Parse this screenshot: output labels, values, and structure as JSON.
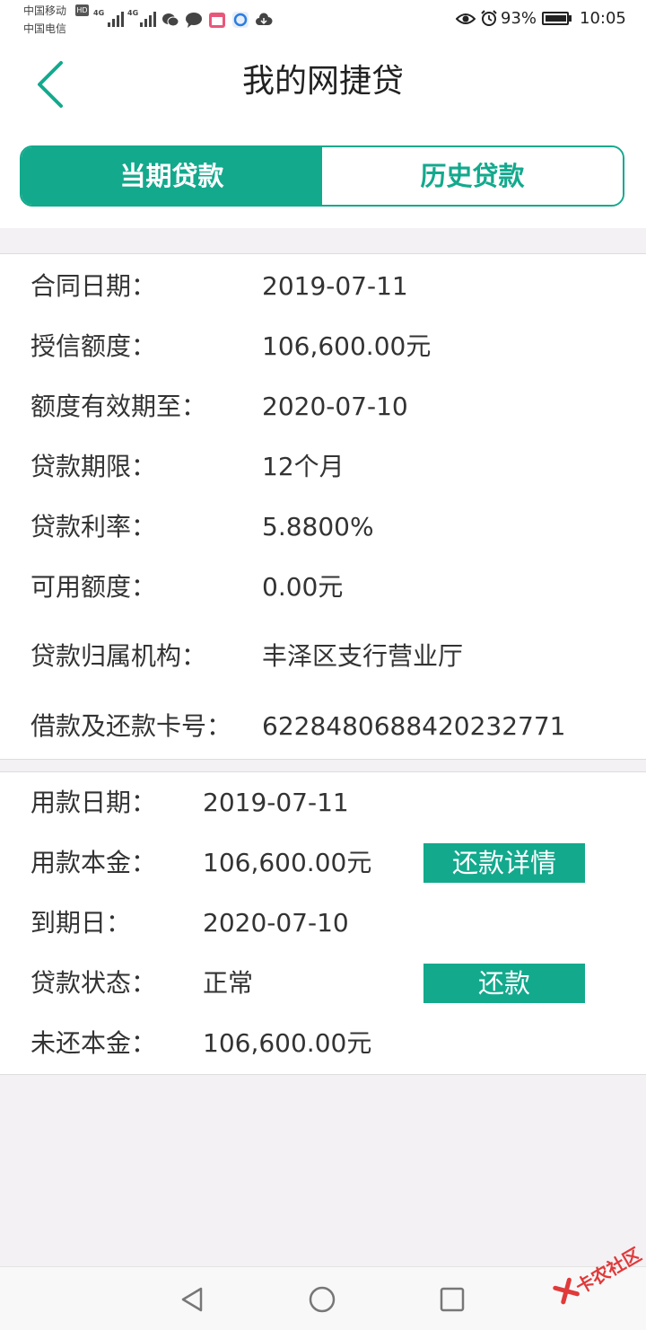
{
  "status_bar": {
    "carrier_1": "中国移动",
    "carrier_2": "中国电信",
    "hd": "HD",
    "network_1": "4G",
    "network_2": "4G",
    "battery_percent": "93%",
    "time": "10:05",
    "icons": [
      "wechat-icon",
      "chat-bubble-icon",
      "calendar-app-icon",
      "browser-app-icon",
      "cloud-app-icon",
      "eye-icon",
      "alarm-icon",
      "battery-icon"
    ]
  },
  "header": {
    "title": "我的网捷贷",
    "back_icon": "chevron-left-icon"
  },
  "tabs": [
    {
      "label": "当期贷款",
      "active": true
    },
    {
      "label": "历史贷款",
      "active": false
    }
  ],
  "contract": [
    {
      "label": "合同日期：",
      "value": "2019-07-11"
    },
    {
      "label": "授信额度：",
      "value": "106,600.00元"
    },
    {
      "label": "额度有效期至：",
      "value": "2020-07-10"
    },
    {
      "label": "贷款期限：",
      "value": "12个月"
    },
    {
      "label": "贷款利率：",
      "value": "5.8800%"
    },
    {
      "label": "可用额度：",
      "value": "0.00元"
    },
    {
      "label": "贷款归属机构：",
      "value": "丰泽区支行营业厅"
    },
    {
      "label": "借款及还款卡号：",
      "value": "6228480688420232771"
    }
  ],
  "loan": [
    {
      "label": "用款日期：",
      "value": "2019-07-11"
    },
    {
      "label": "用款本金：",
      "value": "106,600.00元"
    },
    {
      "label": "到期日：",
      "value": "2020-07-10"
    },
    {
      "label": "贷款状态：",
      "value": "正常"
    },
    {
      "label": "未还本金：",
      "value": "106,600.00元"
    }
  ],
  "actions": {
    "repayment_details": "还款详情",
    "repay": "还款"
  },
  "watermark": {
    "text": "卡农社区"
  },
  "colors": {
    "accent": "#13a98d",
    "background": "#f3f1f4"
  }
}
